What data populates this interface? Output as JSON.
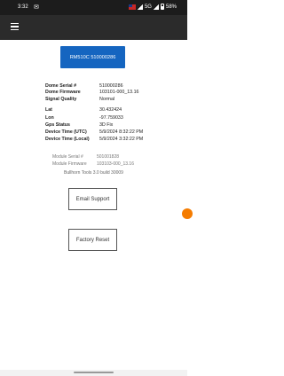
{
  "status_bar": {
    "time": "3:32",
    "network": "5G",
    "battery": "58%",
    "icons": [
      "message-icon",
      "flag-icon",
      "signal-icon",
      "wifi-icon",
      "battery-icon"
    ]
  },
  "app_bar": {
    "menu_icon": "hamburger-menu-icon"
  },
  "device_button": {
    "label": "RM510C 510000286",
    "color": "#1565c0"
  },
  "info": [
    {
      "label": "Dome Serial #",
      "value": "510000286"
    },
    {
      "label": "Dome Firmware",
      "value": "103101-000_13.16"
    },
    {
      "label": "Signal Quality",
      "value": "Normal"
    },
    {
      "label": "Lat",
      "value": "30.432424"
    },
    {
      "label": "Lon",
      "value": "-97.759033"
    },
    {
      "label": "Gps Status",
      "value": "3D Fix"
    },
    {
      "label": "Device Time (UTC)",
      "value": "5/9/2024 8:32:22 PM"
    },
    {
      "label": "Device Time (Local)",
      "value": "5/9/2024 3:32:22 PM"
    }
  ],
  "module": [
    {
      "label": "Module Serial #",
      "value": "501001828"
    },
    {
      "label": "Module Firmware",
      "value": "103103-000_13.16"
    }
  ],
  "build": "Bullhorn Tools 3.0 build 30009",
  "buttons": {
    "email_support": "Email Support",
    "factory_reset": "Factory Reset"
  },
  "accent": "#f57c00"
}
